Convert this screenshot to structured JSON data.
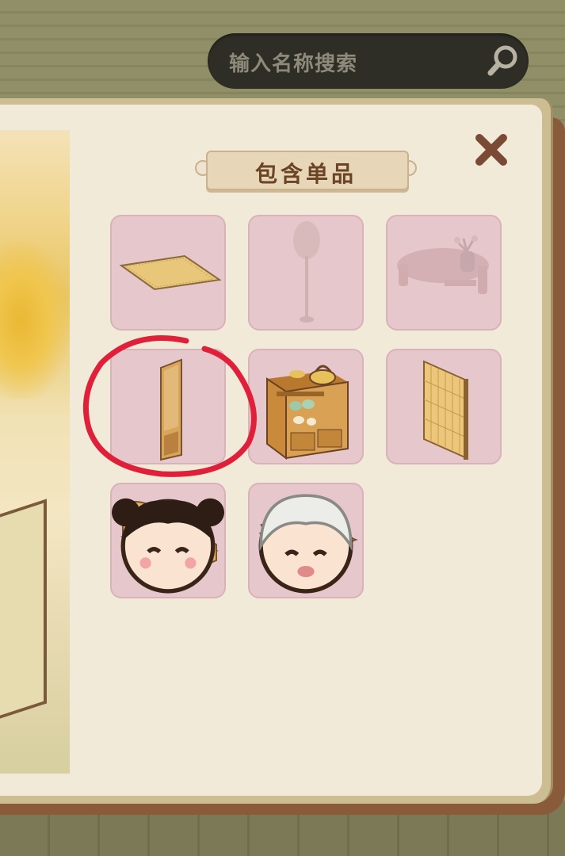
{
  "search": {
    "placeholder": "输入名称搜索"
  },
  "panel": {
    "title": "包含单品"
  },
  "items": [
    {
      "name": "rattan-mat",
      "owned": true
    },
    {
      "name": "round-fan-lamp",
      "owned": false
    },
    {
      "name": "low-tea-table",
      "owned": false
    },
    {
      "name": "wooden-door",
      "owned": true,
      "highlighted": true
    },
    {
      "name": "tea-cabinet",
      "owned": true
    },
    {
      "name": "bamboo-screen",
      "owned": true
    },
    {
      "name": "rattan-bed",
      "owned": true,
      "avatar": "girl-avatar"
    },
    {
      "name": "bamboo-daybed",
      "owned": true,
      "avatar": "white-hair-avatar"
    }
  ],
  "colors": {
    "slot_bg": "#e6c7cc",
    "highlight_circle": "#e0203a",
    "title_text": "#6b4426"
  }
}
